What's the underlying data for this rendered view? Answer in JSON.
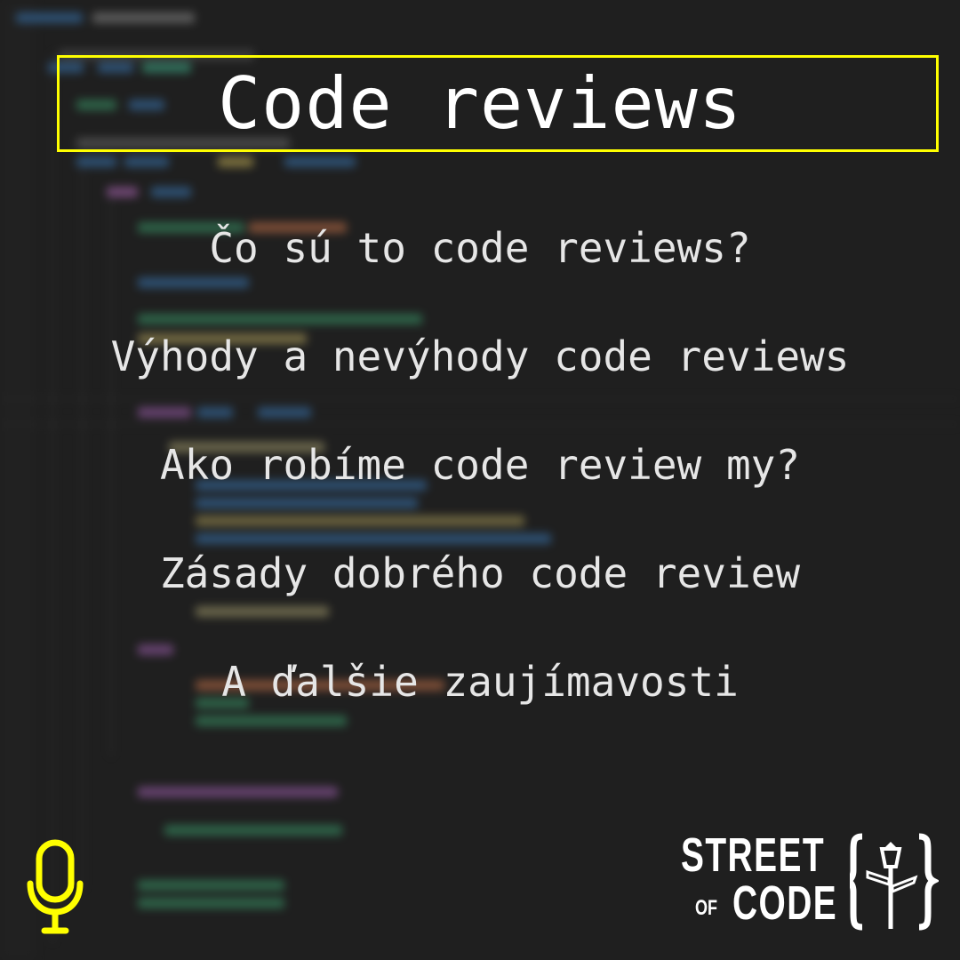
{
  "title": "Code reviews",
  "topics": [
    "Čo sú to code reviews?",
    "Výhody a nevýhody code reviews",
    "Ako robíme code review my?",
    "Zásady dobrého code review",
    "A ďalšie zaujímavosti"
  ],
  "logo": {
    "line1": "STREET",
    "line2_small": "OF",
    "line2": "CODE"
  },
  "icons": {
    "mic": "microphone-icon",
    "logo_mark": "street-lamp-signpost-icon"
  },
  "colors": {
    "background": "#1f1f1f",
    "accent": "#ffff00",
    "title_text": "#ffffff",
    "topic_text": "#e6e6e6"
  }
}
